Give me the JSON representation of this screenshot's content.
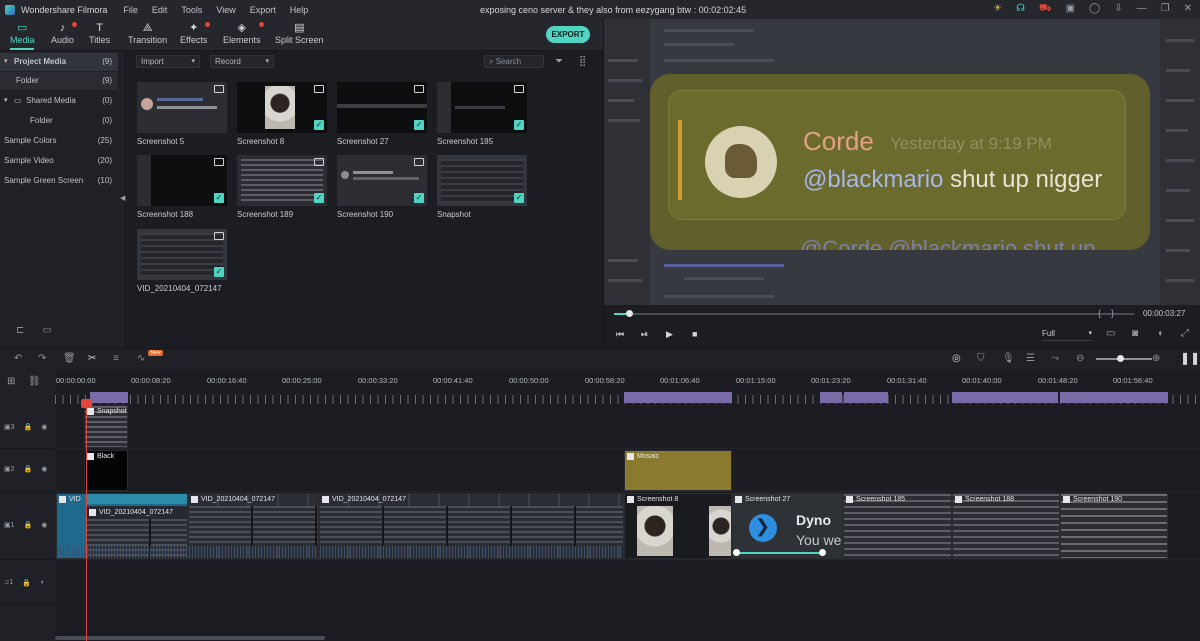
{
  "app": {
    "name": "Wondershare Filmora",
    "document_title": "exposing ceno server & they also from eezygang btw : 00:02:02:45"
  },
  "menu": [
    "File",
    "Edit",
    "Tools",
    "View",
    "Export",
    "Help"
  ],
  "toolbar": {
    "tabs": [
      {
        "label": "Media",
        "icon": "folder-icon",
        "active": true
      },
      {
        "label": "Audio",
        "icon": "music-note-icon",
        "dot": true
      },
      {
        "label": "Titles",
        "icon": "text-t-icon"
      },
      {
        "label": "Transition",
        "icon": "transition-icon"
      },
      {
        "label": "Effects",
        "icon": "effects-icon",
        "dot": true
      },
      {
        "label": "Elements",
        "icon": "elements-icon",
        "dot": true
      },
      {
        "label": "Split Screen",
        "icon": "split-screen-icon"
      }
    ],
    "export_label": "EXPORT"
  },
  "sidebar": {
    "items": [
      {
        "label": "Project Media",
        "count": "(9)"
      },
      {
        "label": "Folder",
        "count": "(9)"
      },
      {
        "label": "Shared Media",
        "count": "(0)"
      },
      {
        "label": "Folder",
        "count": "(0)"
      },
      {
        "label": "Sample Colors",
        "count": "(25)"
      },
      {
        "label": "Sample Video",
        "count": "(20)"
      },
      {
        "label": "Sample Green Screen",
        "count": "(10)"
      }
    ]
  },
  "media": {
    "import_label": "Import",
    "record_label": "Record",
    "search_placeholder": "Search",
    "items": [
      {
        "label": "Screenshot 5"
      },
      {
        "label": "Screenshot 8"
      },
      {
        "label": "Screenshot 27"
      },
      {
        "label": "Screenshot 185"
      },
      {
        "label": "Screenshot 188"
      },
      {
        "label": "Screenshot 189"
      },
      {
        "label": "Screenshot 190"
      },
      {
        "label": "Snapshot"
      },
      {
        "label": "VID_20210404_072147"
      }
    ]
  },
  "preview": {
    "author": "Corde",
    "timestamp": "Yesterday at 9:19 PM",
    "mention": "@blackmario",
    "message_rest": " shut up nigger",
    "below": "@Corde @blackmario shut up",
    "timecode": "00:00:03:27",
    "quality": "Full"
  },
  "ruler": [
    "00:00:00:00",
    "00:00:08:20",
    "00:00:16:40",
    "00:00:25:00",
    "00:00:33:20",
    "00:00:41:40",
    "00:00:50:00",
    "00:00:58:20",
    "00:01:06:40",
    "00:01:15:00",
    "00:01:23:20",
    "00:01:31:40",
    "00:01:40:00",
    "00:01:48:20",
    "00:01:56:40"
  ],
  "timeline": {
    "new_badge": "New",
    "clips_track3": [
      "Snapshot"
    ],
    "clips_track2": [
      "Black",
      "Mosaic"
    ],
    "clips_track1": [
      "VID",
      "VID_20210404_072147",
      "VID_20210404_072147",
      "VID_20210404_072147",
      "Screenshot 8",
      "Screenshot 27",
      "Screenshot 185",
      "Screenshot 188",
      "Screenshot 190"
    ],
    "dyno_text": "Dyno",
    "dyno_sub": "You we"
  },
  "colors": {
    "accent": "#52d4c2",
    "playhead": "#e0453b",
    "mosaic": "#8a7a30"
  }
}
